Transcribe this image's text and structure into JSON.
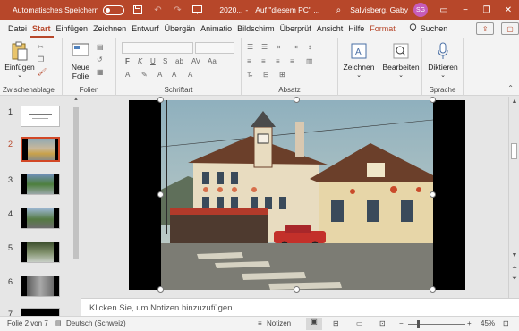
{
  "titlebar": {
    "autosave_label": "Automatisches Speichern",
    "filename": "2020...",
    "saved_location": "Auf \"diesem PC\" ...",
    "user_name": "Salvisberg, Gaby",
    "user_initials": "SG",
    "accent": "#b7472a"
  },
  "tabs": [
    "Datei",
    "Start",
    "Einfügen",
    "Zeichnen",
    "Entwurf",
    "Übergän",
    "Animatio",
    "Bildschirm",
    "Überprüf",
    "Ansicht",
    "Hilfe",
    "Format"
  ],
  "active_tab": "Start",
  "search_label": "Suchen",
  "ribbon": {
    "paste_label": "Einfügen",
    "clipboard_group": "Zwischenablage",
    "new_slide_label": "Neue Folie",
    "slides_group": "Folien",
    "font_group": "Schriftart",
    "paragraph_group": "Absatz",
    "drawing_label": "Zeichnen",
    "editing_label": "Bearbeiten",
    "dictate_label": "Diktieren",
    "voice_group": "Sprache"
  },
  "thumbnails": [
    {
      "num": "1"
    },
    {
      "num": "2"
    },
    {
      "num": "3"
    },
    {
      "num": "4"
    },
    {
      "num": "5"
    },
    {
      "num": "6"
    },
    {
      "num": "7"
    }
  ],
  "active_slide": "2",
  "notes_placeholder": "Klicken Sie, um Notizen hinzuzufügen",
  "status": {
    "slide_info": "Folie 2 von 7",
    "language": "Deutsch (Schweiz)",
    "notes_label": "Notizen",
    "zoom": "45%"
  }
}
